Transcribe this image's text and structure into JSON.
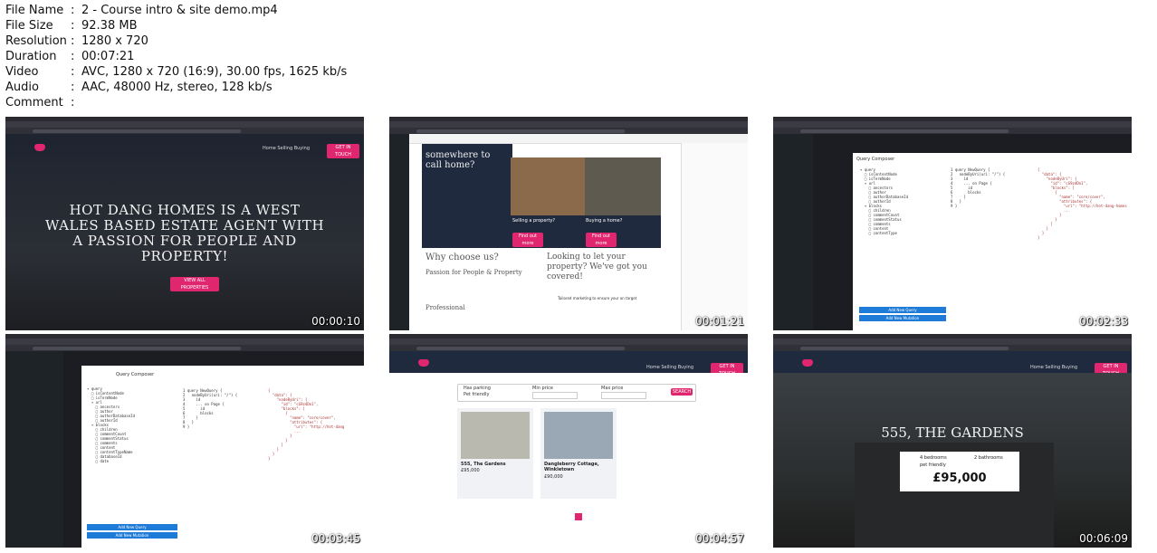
{
  "metadata": [
    {
      "key": "File Name",
      "value": "2 - Course intro & site demo.mp4"
    },
    {
      "key": "File Size",
      "value": "92.38 MB"
    },
    {
      "key": "Resolution",
      "value": "1280 x 720"
    },
    {
      "key": "Duration",
      "value": "00:07:21"
    },
    {
      "key": "Video",
      "value": "AVC, 1280 x 720 (16:9), 30.00 fps, 1625 kb/s"
    },
    {
      "key": "Audio",
      "value": "AAC, 48000 Hz, stereo, 128 kb/s"
    },
    {
      "key": "Comment",
      "value": ""
    }
  ],
  "separator": ":",
  "thumbnails": [
    {
      "timestamp": "00:00:10",
      "hero_title": "HOT DANG HOMES IS A WEST WALES BASED ESTATE AGENT WITH A PASSION FOR PEOPLE AND PROPERTY!",
      "button": "VIEW ALL PROPERTIES",
      "nav": "Home   Selling   Buying",
      "cta": "GET IN TOUCH"
    },
    {
      "timestamp": "00:01:21",
      "heading1": "somewhere to call home?",
      "heading2": "Why choose us?",
      "heading3": "Passion for People & Property",
      "heading4": "Looking to let your property? We've got you covered!",
      "heading5": "Professional",
      "btn1": "Find out more",
      "btn2": "Find out more",
      "label1": "Selling a property?",
      "label2": "Buying a home?",
      "tailored": "Tailored marketing to ensure your on target"
    },
    {
      "timestamp": "00:02:33",
      "panel_title": "Query Composer",
      "btn1": "Add New Query",
      "btn2": "Add New Mutation"
    },
    {
      "timestamp": "00:03:45",
      "panel_title": "Query Composer",
      "btn1": "Add New Query",
      "btn2": "Add New Mutation"
    },
    {
      "timestamp": "00:04:57",
      "filter1": "Has parking",
      "filter2": "Pet friendly",
      "min": "Min price",
      "max": "Max price",
      "search": "SEARCH",
      "card1_title": "555, The Gardens",
      "card1_price": "£95,000",
      "card2_title": "Dangleberry Cottage, Winkletown",
      "card2_price": "£90,000",
      "nav": "Home   Selling   Buying",
      "cta": "GET IN TOUCH"
    },
    {
      "timestamp": "00:06:09",
      "title": "555, THE GARDENS",
      "beds": "4 bedrooms",
      "baths": "2 bathrooms",
      "pet": "pet friendly",
      "price": "£95,000",
      "nav": "Home   Selling   Buying",
      "cta": "GET IN TOUCH"
    }
  ]
}
